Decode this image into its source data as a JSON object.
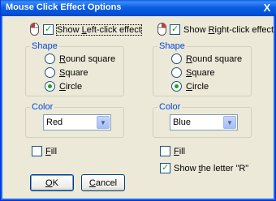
{
  "title": "Mouse Click Effect Options",
  "close_glyph": "X",
  "left": {
    "show_pre": "Show ",
    "show_ul": "L",
    "show_post": "eft-click effect",
    "show_checked": true,
    "shape_label": "Shape",
    "shapes": [
      {
        "ul": "R",
        "rest": "ound square"
      },
      {
        "ul": "S",
        "rest": "quare"
      },
      {
        "ul": "C",
        "rest": "ircle"
      }
    ],
    "shape_selected": "Circle",
    "color_label": "Color",
    "color_value": "Red",
    "fill_ul": "F",
    "fill_rest": "ill",
    "fill_checked": false
  },
  "right": {
    "show_pre": "Show ",
    "show_ul": "R",
    "show_post": "ight-click effect",
    "show_checked": true,
    "shape_label": "Shape",
    "shapes": [
      {
        "ul": "R",
        "rest": "ound square"
      },
      {
        "ul": "S",
        "rest": "quare"
      },
      {
        "ul": "C",
        "rest": "ircle"
      }
    ],
    "shape_selected": "Circle",
    "color_label": "Color",
    "color_value": "Blue",
    "fill_ul": "F",
    "fill_rest": "ill",
    "fill_checked": false,
    "letter_pre": "Show ",
    "letter_ul": "t",
    "letter_post": "he letter \"R\"",
    "letter_checked": true
  },
  "buttons": {
    "ok_ul": "O",
    "ok_rest": "K",
    "cancel_ul": "C",
    "cancel_rest": "ancel"
  },
  "colors": {
    "titlebar": "#0A5FE6",
    "accent_red": "#E03030",
    "check_green": "#21A121",
    "legend_blue": "#0046D5"
  }
}
